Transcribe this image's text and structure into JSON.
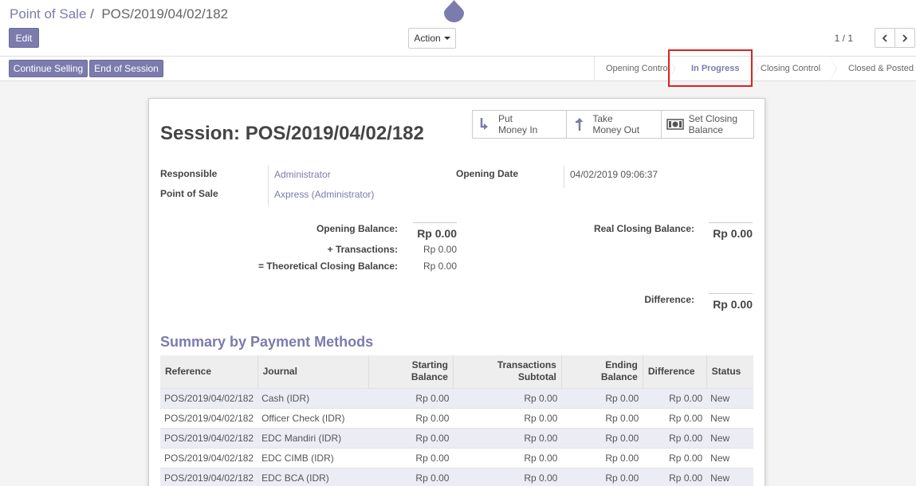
{
  "breadcrumb": {
    "parent": "Point of Sale",
    "separator": "/",
    "current": "POS/2019/04/02/182"
  },
  "toolbar": {
    "edit_label": "Edit",
    "action_label": "Action"
  },
  "pager": {
    "value": "1 / 1"
  },
  "buttons": {
    "continue_selling": "Continue Selling",
    "end_of_session": "End of Session"
  },
  "statusbar": {
    "stages": [
      "Opening Control",
      "In Progress",
      "Closing Control",
      "Closed & Posted"
    ],
    "active": "In Progress"
  },
  "session": {
    "title": "Session: POS/2019/04/02/182",
    "smart_buttons": [
      {
        "line1": "Put",
        "line2": "Money In",
        "icon": "money-in-icon"
      },
      {
        "line1": "Take",
        "line2": "Money Out",
        "icon": "money-out-icon"
      },
      {
        "line1": "Set Closing",
        "line2": "Balance",
        "icon": "cash-icon"
      }
    ],
    "responsible_label": "Responsible",
    "responsible": "Administrator",
    "pos_label": "Point of Sale",
    "pos": "Axpress (Administrator)",
    "opening_date_label": "Opening Date",
    "opening_date": "04/02/2019 09:06:37",
    "opening_balance_label": "Opening Balance:",
    "opening_balance": "Rp 0.00",
    "transactions_label": "+ Transactions:",
    "transactions": "Rp 0.00",
    "theoretical_label": "= Theoretical Closing Balance:",
    "theoretical": "Rp 0.00",
    "real_closing_label": "Real Closing Balance:",
    "real_closing": "Rp 0.00",
    "difference_label": "Difference:",
    "difference": "Rp 0.00"
  },
  "summary": {
    "title": "Summary by Payment Methods",
    "headers": {
      "reference": "Reference",
      "journal": "Journal",
      "starting_1": "Starting",
      "starting_2": "Balance",
      "transactions_1": "Transactions",
      "transactions_2": "Subtotal",
      "ending_1": "Ending",
      "ending_2": "Balance",
      "difference": "Difference",
      "status": "Status"
    },
    "rows": [
      {
        "reference": "POS/2019/04/02/182",
        "journal": "Cash (IDR)",
        "starting": "Rp 0.00",
        "subtotal": "Rp 0.00",
        "ending": "Rp 0.00",
        "difference": "Rp 0.00",
        "status": "New"
      },
      {
        "reference": "POS/2019/04/02/182",
        "journal": "Officer Check (IDR)",
        "starting": "Rp 0.00",
        "subtotal": "Rp 0.00",
        "ending": "Rp 0.00",
        "difference": "Rp 0.00",
        "status": "New"
      },
      {
        "reference": "POS/2019/04/02/182",
        "journal": "EDC Mandiri (IDR)",
        "starting": "Rp 0.00",
        "subtotal": "Rp 0.00",
        "ending": "Rp 0.00",
        "difference": "Rp 0.00",
        "status": "New"
      },
      {
        "reference": "POS/2019/04/02/182",
        "journal": "EDC CIMB (IDR)",
        "starting": "Rp 0.00",
        "subtotal": "Rp 0.00",
        "ending": "Rp 0.00",
        "difference": "Rp 0.00",
        "status": "New"
      },
      {
        "reference": "POS/2019/04/02/182",
        "journal": "EDC BCA (IDR)",
        "starting": "Rp 0.00",
        "subtotal": "Rp 0.00",
        "ending": "Rp 0.00",
        "difference": "Rp 0.00",
        "status": "New"
      }
    ]
  },
  "colors": {
    "accent": "#7c7bad",
    "highlight": "#e02020"
  }
}
